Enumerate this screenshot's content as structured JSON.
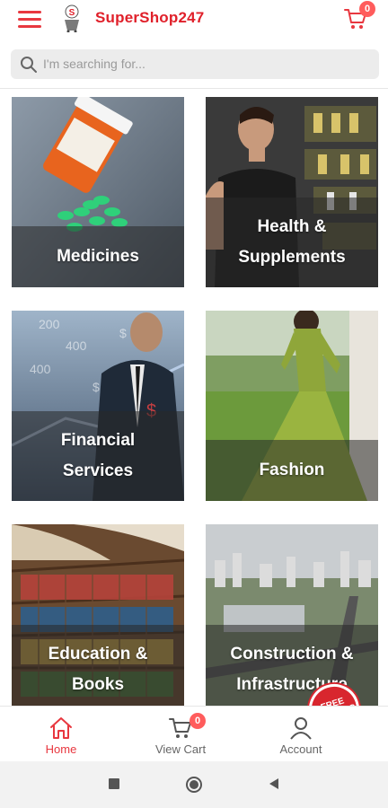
{
  "header": {
    "brand": "SuperShop247",
    "cart_count": "0"
  },
  "search": {
    "placeholder": "I'm searching for..."
  },
  "categories": [
    {
      "label": "Medicines"
    },
    {
      "label": "Health &\nSupplements"
    },
    {
      "label": "Financial\nServices"
    },
    {
      "label": "Fashion"
    },
    {
      "label": "Education &\nBooks"
    },
    {
      "label": "Construction &\nInfrastructure"
    }
  ],
  "stamp": {
    "text": "FREE\nSHIPPING"
  },
  "bottom_nav": {
    "home": "Home",
    "view_cart": "View Cart",
    "cart_count": "0",
    "account": "Account"
  },
  "colors": {
    "accent": "#e8373f",
    "badge": "#ff5c5c"
  }
}
